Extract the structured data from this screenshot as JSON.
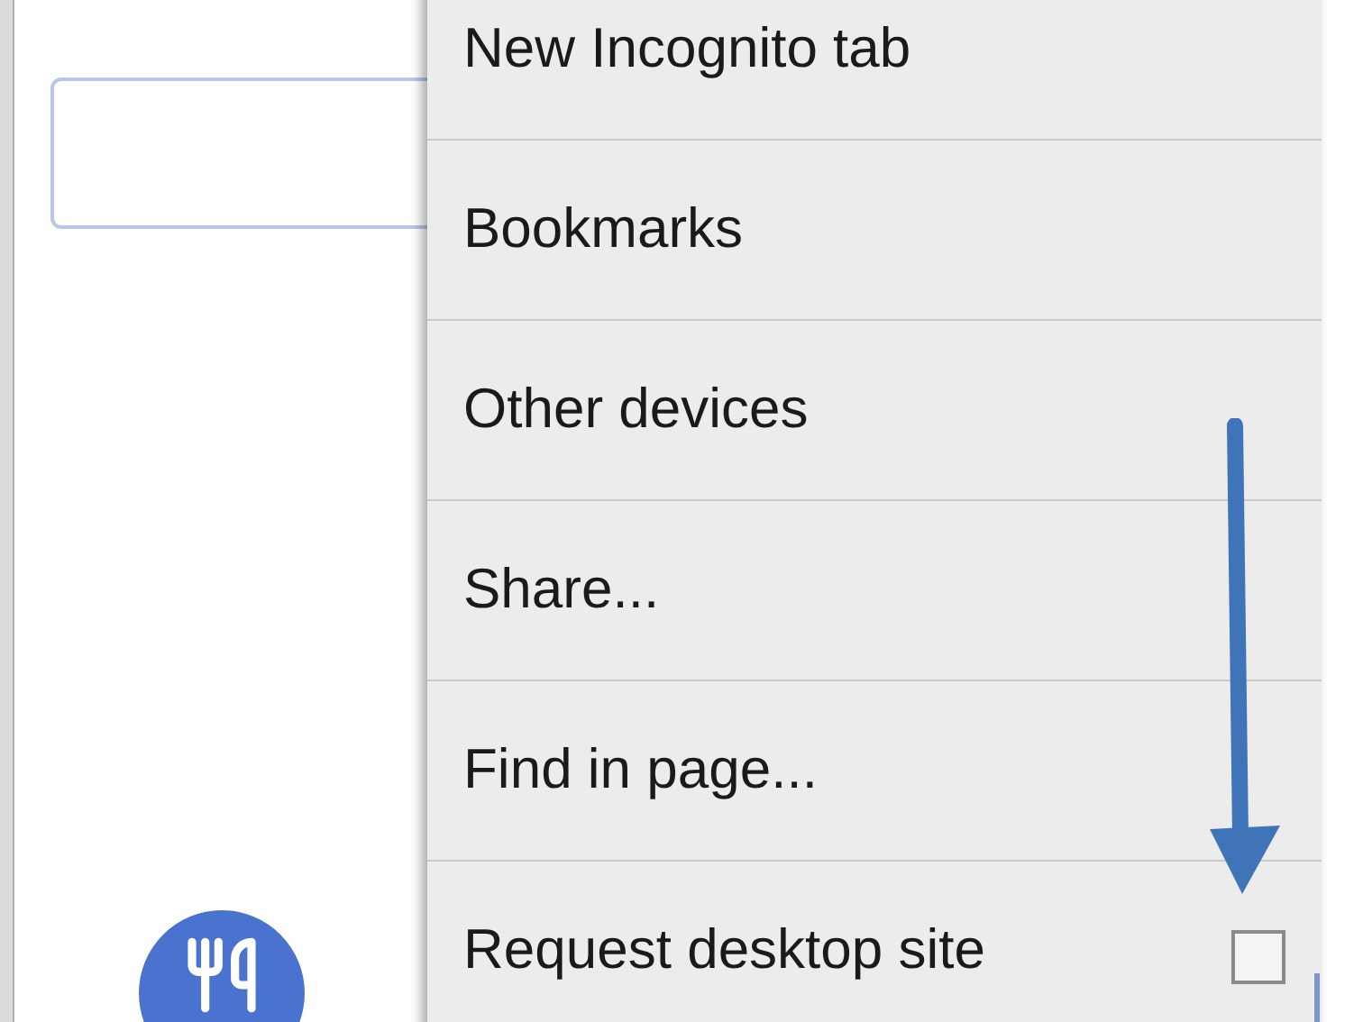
{
  "menu": {
    "items": [
      {
        "kind": "plain",
        "label": "New Incognito tab"
      },
      {
        "kind": "plain",
        "label": "Bookmarks"
      },
      {
        "kind": "plain",
        "label": "Other devices"
      },
      {
        "kind": "plain",
        "label": "Share..."
      },
      {
        "kind": "plain",
        "label": "Find in page..."
      },
      {
        "kind": "checkbox",
        "label": "Request desktop site",
        "checked": false
      }
    ]
  }
}
